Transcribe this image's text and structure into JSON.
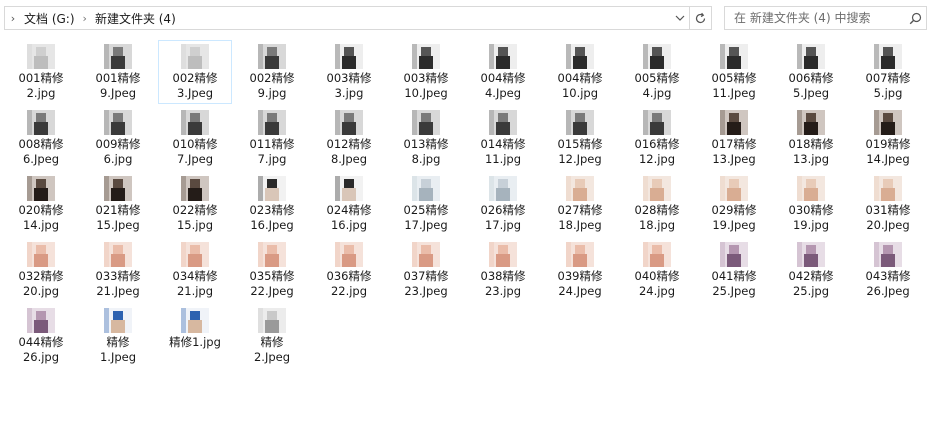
{
  "address": {
    "breadcrumbs": [
      "文档 (G:)",
      "新建文件夹 (4)"
    ]
  },
  "search": {
    "placeholder": "在 新建文件夹 (4) 中搜索"
  },
  "files": [
    {
      "line1": "001精修",
      "line2": "2.jpg",
      "tone": "pale"
    },
    {
      "line1": "001精修",
      "line2": "9.Jpeg",
      "tone": "dark"
    },
    {
      "line1": "002精修",
      "line2": "3.Jpeg",
      "tone": "pale"
    },
    {
      "line1": "002精修",
      "line2": "9.jpg",
      "tone": "dark"
    },
    {
      "line1": "003精修",
      "line2": "3.jpg",
      "tone": "figure"
    },
    {
      "line1": "003精修",
      "line2": "10.Jpeg",
      "tone": "figure"
    },
    {
      "line1": "004精修",
      "line2": "4.Jpeg",
      "tone": "figure"
    },
    {
      "line1": "004精修",
      "line2": "10.jpg",
      "tone": "figure"
    },
    {
      "line1": "005精修",
      "line2": "4.jpg",
      "tone": "figure"
    },
    {
      "line1": "005精修",
      "line2": "11.Jpeg",
      "tone": "figure"
    },
    {
      "line1": "006精修",
      "line2": "5.Jpeg",
      "tone": "figure"
    },
    {
      "line1": "007精修",
      "line2": "5.jpg",
      "tone": "figure"
    },
    {
      "line1": "008精修",
      "line2": "6.Jpeg",
      "tone": "dark"
    },
    {
      "line1": "009精修",
      "line2": "6.jpg",
      "tone": "dark"
    },
    {
      "line1": "010精修",
      "line2": "7.Jpeg",
      "tone": "dark"
    },
    {
      "line1": "011精修",
      "line2": "7.jpg",
      "tone": "dark"
    },
    {
      "line1": "012精修",
      "line2": "8.Jpeg",
      "tone": "dark"
    },
    {
      "line1": "013精修",
      "line2": "8.jpg",
      "tone": "dark"
    },
    {
      "line1": "014精修",
      "line2": "11.jpg",
      "tone": "dark"
    },
    {
      "line1": "015精修",
      "line2": "12.Jpeg",
      "tone": "dark"
    },
    {
      "line1": "016精修",
      "line2": "12.jpg",
      "tone": "dark"
    },
    {
      "line1": "017精修",
      "line2": "13.Jpeg",
      "tone": "warmdark"
    },
    {
      "line1": "018精修",
      "line2": "13.jpg",
      "tone": "warmdark"
    },
    {
      "line1": "019精修",
      "line2": "14.Jpeg",
      "tone": "warmdark"
    },
    {
      "line1": "020精修",
      "line2": "14.jpg",
      "tone": "warmdark"
    },
    {
      "line1": "021精修",
      "line2": "15.Jpeg",
      "tone": "warmdark"
    },
    {
      "line1": "022精修",
      "line2": "15.jpg",
      "tone": "warmdark"
    },
    {
      "line1": "023精修",
      "line2": "16.Jpeg",
      "tone": "suit"
    },
    {
      "line1": "024精修",
      "line2": "16.jpg",
      "tone": "suit"
    },
    {
      "line1": "025精修",
      "line2": "17.Jpeg",
      "tone": "light"
    },
    {
      "line1": "026精修",
      "line2": "17.jpg",
      "tone": "light"
    },
    {
      "line1": "027精修",
      "line2": "18.Jpeg",
      "tone": "skin"
    },
    {
      "line1": "028精修",
      "line2": "18.jpg",
      "tone": "skin"
    },
    {
      "line1": "029精修",
      "line2": "19.Jpeg",
      "tone": "skin"
    },
    {
      "line1": "030精修",
      "line2": "19.jpg",
      "tone": "skin"
    },
    {
      "line1": "031精修",
      "line2": "20.Jpeg",
      "tone": "skin"
    },
    {
      "line1": "032精修",
      "line2": "20.jpg",
      "tone": "pink"
    },
    {
      "line1": "033精修",
      "line2": "21.Jpeg",
      "tone": "pink"
    },
    {
      "line1": "034精修",
      "line2": "21.jpg",
      "tone": "pink"
    },
    {
      "line1": "035精修",
      "line2": "22.Jpeg",
      "tone": "pink"
    },
    {
      "line1": "036精修",
      "line2": "22.jpg",
      "tone": "pink"
    },
    {
      "line1": "037精修",
      "line2": "23.Jpeg",
      "tone": "pink"
    },
    {
      "line1": "038精修",
      "line2": "23.jpg",
      "tone": "pink"
    },
    {
      "line1": "039精修",
      "line2": "24.Jpeg",
      "tone": "pink"
    },
    {
      "line1": "040精修",
      "line2": "24.jpg",
      "tone": "pink"
    },
    {
      "line1": "041精修",
      "line2": "25.Jpeg",
      "tone": "mauve"
    },
    {
      "line1": "042精修",
      "line2": "25.jpg",
      "tone": "mauve"
    },
    {
      "line1": "043精修",
      "line2": "26.Jpeg",
      "tone": "mauve"
    },
    {
      "line1": "044精修",
      "line2": "26.jpg",
      "tone": "mauve"
    },
    {
      "line1": "精修",
      "line2": "1.Jpeg",
      "tone": "blue"
    },
    {
      "line1": "精修1.jpg",
      "line2": "",
      "tone": "blue"
    },
    {
      "line1": "精修",
      "line2": "2.Jpeg",
      "tone": "gray"
    }
  ],
  "selected_index": 2,
  "colors": {
    "selection_border": "#cce8ff",
    "field_border": "#d9d9d9"
  }
}
